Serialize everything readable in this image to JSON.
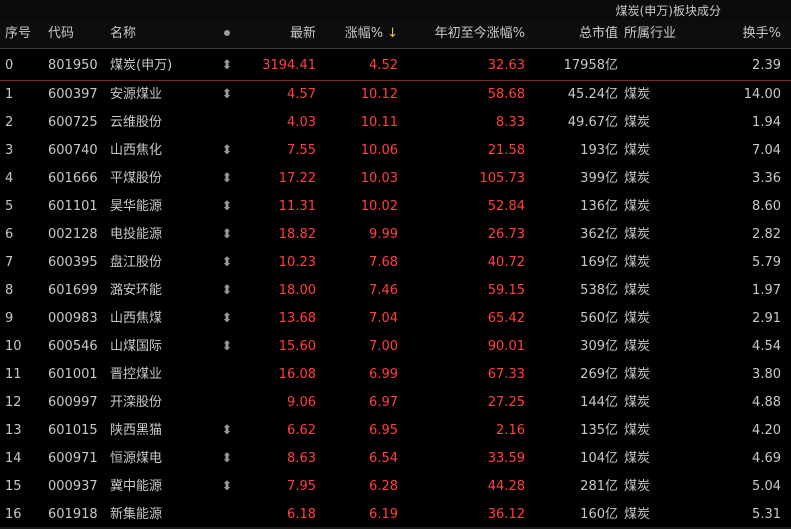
{
  "board_title": "煤炭(申万)板块成分",
  "columns": {
    "seq": "序号",
    "code": "代码",
    "name": "名称",
    "last": "最新",
    "pct": "涨幅%",
    "sort_indicator": "↓",
    "ytd": "年初至今涨幅%",
    "cap": "总市值",
    "industry": "所属行业",
    "turnover": "换手%"
  },
  "icons": {
    "header_dot": "circle-icon",
    "row_flag": "updown-arrow-icon",
    "flag_glyph": "⬍"
  },
  "colors": {
    "up": "#ff4040",
    "text": "#c8c8c8",
    "background": "#000000",
    "sort_arrow": "#e8c24a"
  },
  "rows": [
    {
      "seq": "0",
      "code": "801950",
      "name": "煤炭(申万)",
      "flag": true,
      "last": "3194.41",
      "pct": "4.52",
      "ytd": "32.63",
      "cap": "17958亿",
      "industry": "",
      "turnover": "2.39"
    },
    {
      "seq": "1",
      "code": "600397",
      "name": "安源煤业",
      "flag": true,
      "last": "4.57",
      "pct": "10.12",
      "ytd": "58.68",
      "cap": "45.24亿",
      "industry": "煤炭",
      "turnover": "14.00"
    },
    {
      "seq": "2",
      "code": "600725",
      "name": "云维股份",
      "flag": false,
      "last": "4.03",
      "pct": "10.11",
      "ytd": "8.33",
      "cap": "49.67亿",
      "industry": "煤炭",
      "turnover": "1.94"
    },
    {
      "seq": "3",
      "code": "600740",
      "name": "山西焦化",
      "flag": true,
      "last": "7.55",
      "pct": "10.06",
      "ytd": "21.58",
      "cap": "193亿",
      "industry": "煤炭",
      "turnover": "7.04"
    },
    {
      "seq": "4",
      "code": "601666",
      "name": "平煤股份",
      "flag": true,
      "last": "17.22",
      "pct": "10.03",
      "ytd": "105.73",
      "cap": "399亿",
      "industry": "煤炭",
      "turnover": "3.36"
    },
    {
      "seq": "5",
      "code": "601101",
      "name": "昊华能源",
      "flag": true,
      "last": "11.31",
      "pct": "10.02",
      "ytd": "52.84",
      "cap": "136亿",
      "industry": "煤炭",
      "turnover": "8.60"
    },
    {
      "seq": "6",
      "code": "002128",
      "name": "电投能源",
      "flag": true,
      "last": "18.82",
      "pct": "9.99",
      "ytd": "26.73",
      "cap": "362亿",
      "industry": "煤炭",
      "turnover": "2.82"
    },
    {
      "seq": "7",
      "code": "600395",
      "name": "盘江股份",
      "flag": true,
      "last": "10.23",
      "pct": "7.68",
      "ytd": "40.72",
      "cap": "169亿",
      "industry": "煤炭",
      "turnover": "5.79"
    },
    {
      "seq": "8",
      "code": "601699",
      "name": "潞安环能",
      "flag": true,
      "last": "18.00",
      "pct": "7.46",
      "ytd": "59.15",
      "cap": "538亿",
      "industry": "煤炭",
      "turnover": "1.97"
    },
    {
      "seq": "9",
      "code": "000983",
      "name": "山西焦煤",
      "flag": true,
      "last": "13.68",
      "pct": "7.04",
      "ytd": "65.42",
      "cap": "560亿",
      "industry": "煤炭",
      "turnover": "2.91"
    },
    {
      "seq": "10",
      "code": "600546",
      "name": "山煤国际",
      "flag": true,
      "last": "15.60",
      "pct": "7.00",
      "ytd": "90.01",
      "cap": "309亿",
      "industry": "煤炭",
      "turnover": "4.54"
    },
    {
      "seq": "11",
      "code": "601001",
      "name": "晋控煤业",
      "flag": false,
      "last": "16.08",
      "pct": "6.99",
      "ytd": "67.33",
      "cap": "269亿",
      "industry": "煤炭",
      "turnover": "3.80"
    },
    {
      "seq": "12",
      "code": "600997",
      "name": "开滦股份",
      "flag": false,
      "last": "9.06",
      "pct": "6.97",
      "ytd": "27.25",
      "cap": "144亿",
      "industry": "煤炭",
      "turnover": "4.88"
    },
    {
      "seq": "13",
      "code": "601015",
      "name": "陕西黑猫",
      "flag": true,
      "last": "6.62",
      "pct": "6.95",
      "ytd": "2.16",
      "cap": "135亿",
      "industry": "煤炭",
      "turnover": "4.20"
    },
    {
      "seq": "14",
      "code": "600971",
      "name": "恒源煤电",
      "flag": true,
      "last": "8.63",
      "pct": "6.54",
      "ytd": "33.59",
      "cap": "104亿",
      "industry": "煤炭",
      "turnover": "4.69"
    },
    {
      "seq": "15",
      "code": "000937",
      "name": "冀中能源",
      "flag": true,
      "last": "7.95",
      "pct": "6.28",
      "ytd": "44.28",
      "cap": "281亿",
      "industry": "煤炭",
      "turnover": "5.04"
    },
    {
      "seq": "16",
      "code": "601918",
      "name": "新集能源",
      "flag": false,
      "last": "6.18",
      "pct": "6.19",
      "ytd": "36.12",
      "cap": "160亿",
      "industry": "煤炭",
      "turnover": "5.31"
    }
  ]
}
